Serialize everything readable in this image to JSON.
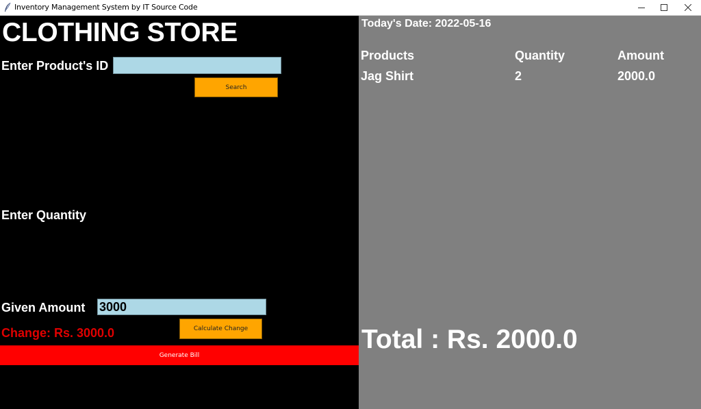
{
  "window": {
    "title": "Inventory Management System by IT Source Code",
    "icon": "feather-icon",
    "controls": {
      "minimize": "—",
      "maximize": "☐",
      "close": "✕"
    }
  },
  "left": {
    "store_title": "CLOTHING STORE",
    "product_id_label": "Enter Product's ID",
    "product_id_value": "",
    "search_label": "Search",
    "quantity_label": "Enter Quantity",
    "given_amount_label": "Given Amount",
    "given_amount_value": "3000",
    "calculate_label": "Calculate Change",
    "change_text": "Change: Rs. 3000.0",
    "generate_bill_label": "Generate Bill"
  },
  "right": {
    "date_text": "Today's Date: 2022-05-16",
    "columns": [
      "Products",
      "Quantity",
      "Amount"
    ],
    "items": [
      {
        "product": "Jag Shirt",
        "quantity": "2",
        "amount": "2000.0"
      }
    ],
    "total_text": "Total : Rs. 2000.0"
  },
  "colors": {
    "left_bg": "#000000",
    "right_bg": "#808080",
    "entry_bg": "#add8e6",
    "button_orange": "#ffa500",
    "bill_red": "#ff0000",
    "change_red": "#e00000"
  }
}
